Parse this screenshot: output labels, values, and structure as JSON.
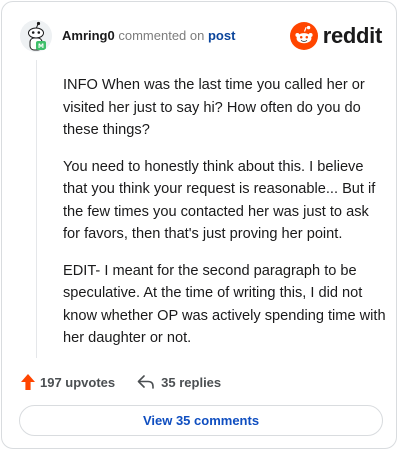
{
  "header": {
    "username": "Amring0",
    "verb": "commented on",
    "target": "post",
    "logo_text": "reddit",
    "brand_color": "#ff4500"
  },
  "comment": {
    "paragraphs": [
      "INFO When was the last time you called her or visited her just to say hi? How often do you do these things?",
      "You need to honestly think about this. I believe that you think your request is reasonable... But if the few times you contacted her was just to ask for favors, then that's just proving her point.",
      "EDIT- I meant for the second paragraph to be speculative. At the time of writing this, I did not know whether OP was actively spending time with her daughter or not."
    ]
  },
  "actions": {
    "upvotes": "197 upvotes",
    "replies": "35 replies",
    "upvote_icon": "upvote-arrow-icon",
    "reply_icon": "reply-arrow-icon",
    "upvote_color": "#ff4500"
  },
  "footer": {
    "view_comments": "View 35 comments",
    "link_color": "#0f4ec0"
  },
  "icons": {
    "avatar": "snoo-avatar",
    "logo": "reddit-snoo-logo-icon"
  }
}
